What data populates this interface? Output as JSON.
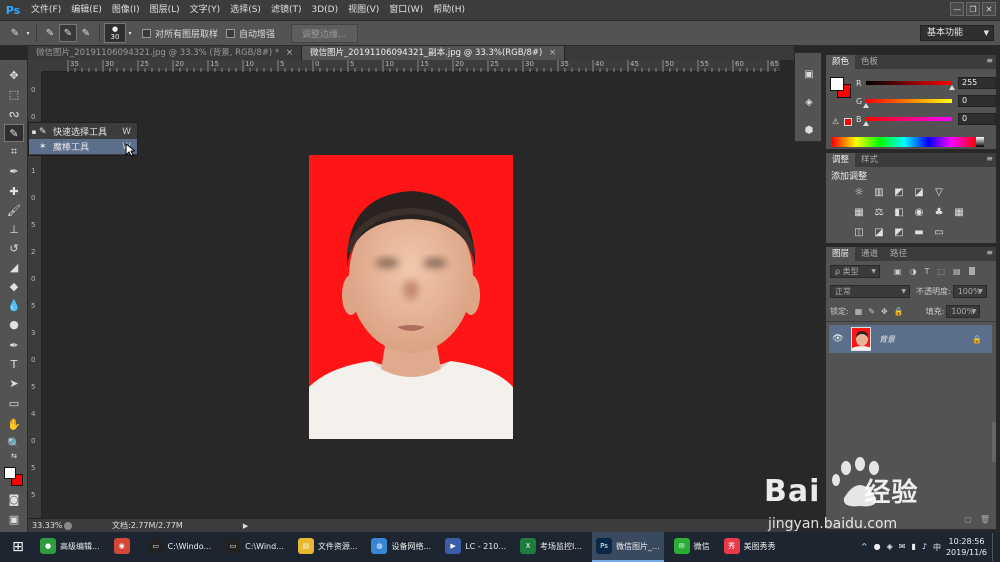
{
  "app": {
    "logo": "Ps",
    "menus": [
      "文件(F)",
      "编辑(E)",
      "图像(I)",
      "图层(L)",
      "文字(Y)",
      "选择(S)",
      "滤镜(T)",
      "3D(D)",
      "视图(V)",
      "窗口(W)",
      "帮助(H)"
    ],
    "window_controls": [
      "—",
      "❐",
      "✕"
    ]
  },
  "options": {
    "brush_size": "30",
    "sample_all_label": "对所有图层取样",
    "auto_enhance_label": "自动增强",
    "refine_edge_label": "调整边缘...",
    "workspace": "基本功能"
  },
  "tabs": [
    {
      "label": "微信图片_20191106094321.jpg @ 33.3% (背景, RGB/8#) *",
      "close": "×",
      "active": false
    },
    {
      "label": "微信图片_20191106094321_副本.jpg @ 33.3%(RGB/8#)",
      "close": "×",
      "active": true
    }
  ],
  "rulers": {
    "top": [
      "35",
      "30",
      "25",
      "20",
      "15",
      "10",
      "5",
      "0",
      "5",
      "10",
      "15",
      "20",
      "25",
      "30",
      "35",
      "40",
      "45",
      "50",
      "55",
      "60",
      "65",
      "70",
      "75"
    ],
    "left": [
      "0",
      "0",
      "5",
      "1",
      "0",
      "5",
      "2",
      "0",
      "5",
      "3",
      "0",
      "5",
      "4",
      "0",
      "5",
      "5"
    ]
  },
  "flyout": {
    "items": [
      {
        "bullet": "▪",
        "label": "快速选择工具",
        "shortcut": "W"
      },
      {
        "bullet": "",
        "label": "魔棒工具",
        "shortcut": "W"
      }
    ]
  },
  "status": {
    "zoom": "33.33%",
    "doc": "文档:2.77M/2.77M"
  },
  "color_panel": {
    "tabs": [
      "颜色",
      "色板"
    ],
    "channels": [
      {
        "name": "R",
        "value": "255",
        "level": 1.0,
        "gradient": "linear-gradient(to right,#000,#ff0000)"
      },
      {
        "name": "G",
        "value": "0",
        "level": 0.0,
        "gradient": "linear-gradient(to right,#ff0000,#ffff00)"
      },
      {
        "name": "B",
        "value": "0",
        "level": 0.0,
        "gradient": "linear-gradient(to right,#ff0000,#ff00ff)"
      }
    ],
    "foreground": "#ffffff",
    "background": "#ff0000"
  },
  "adjust_panel": {
    "tabs": [
      "调整",
      "样式"
    ],
    "title": "添加调整",
    "row1": [
      "☼",
      "▥",
      "◩",
      "◪",
      "▽"
    ],
    "row2": [
      "▦",
      "⚖",
      "◧",
      "◉",
      "♣",
      "▦"
    ],
    "row3": [
      "◫",
      "◪",
      "◩",
      "▬",
      "▭"
    ]
  },
  "layers_panel": {
    "tabs": [
      "图层",
      "通道",
      "路径"
    ],
    "filter": "ρ 类型",
    "blend_mode": "正常",
    "opacity_label": "不透明度:",
    "opacity": "100%",
    "lock_label": "锁定:",
    "fill_label": "填充:",
    "fill": "100%",
    "layer_name": "背景",
    "eye": "👁",
    "lock": "🔒"
  },
  "taskbar": {
    "start": "⊞",
    "items": [
      {
        "label": "高级编辑...",
        "color": "#2e9d3f",
        "icon": "●",
        "active": false
      },
      {
        "label": "",
        "color": "#d24a36",
        "icon": "◉",
        "active": false
      },
      {
        "label": "C:\\Windo...",
        "color": "#222222",
        "icon": "▭",
        "active": false
      },
      {
        "label": "C:\\Wind...",
        "color": "#222222",
        "icon": "▭",
        "active": false
      },
      {
        "label": "文件资源...",
        "color": "#e8b830",
        "icon": "▤",
        "active": false
      },
      {
        "label": "设备网络...",
        "color": "#3a86d6",
        "icon": "◍",
        "active": false
      },
      {
        "label": "LC - 210...",
        "color": "#3a5ea8",
        "icon": "▶",
        "active": false
      },
      {
        "label": "考场监控I...",
        "color": "#1f7a3e",
        "icon": "X",
        "active": false
      },
      {
        "label": "微信图片_...",
        "color": "#0a2848",
        "icon": "Ps",
        "active": true
      },
      {
        "label": "微信",
        "color": "#2aae38",
        "icon": "✉",
        "active": false
      },
      {
        "label": "美图秀秀",
        "color": "#e83a4a",
        "icon": "秀",
        "active": false
      }
    ],
    "tray_icons": [
      "^",
      "●",
      "◈",
      "✉",
      "▮",
      "♪",
      "中"
    ],
    "time": "10:28:56",
    "date": "2019/11/6"
  },
  "watermark": {
    "brand": "Bai",
    "suffix": "经验",
    "url": "jingyan.baidu.com"
  }
}
